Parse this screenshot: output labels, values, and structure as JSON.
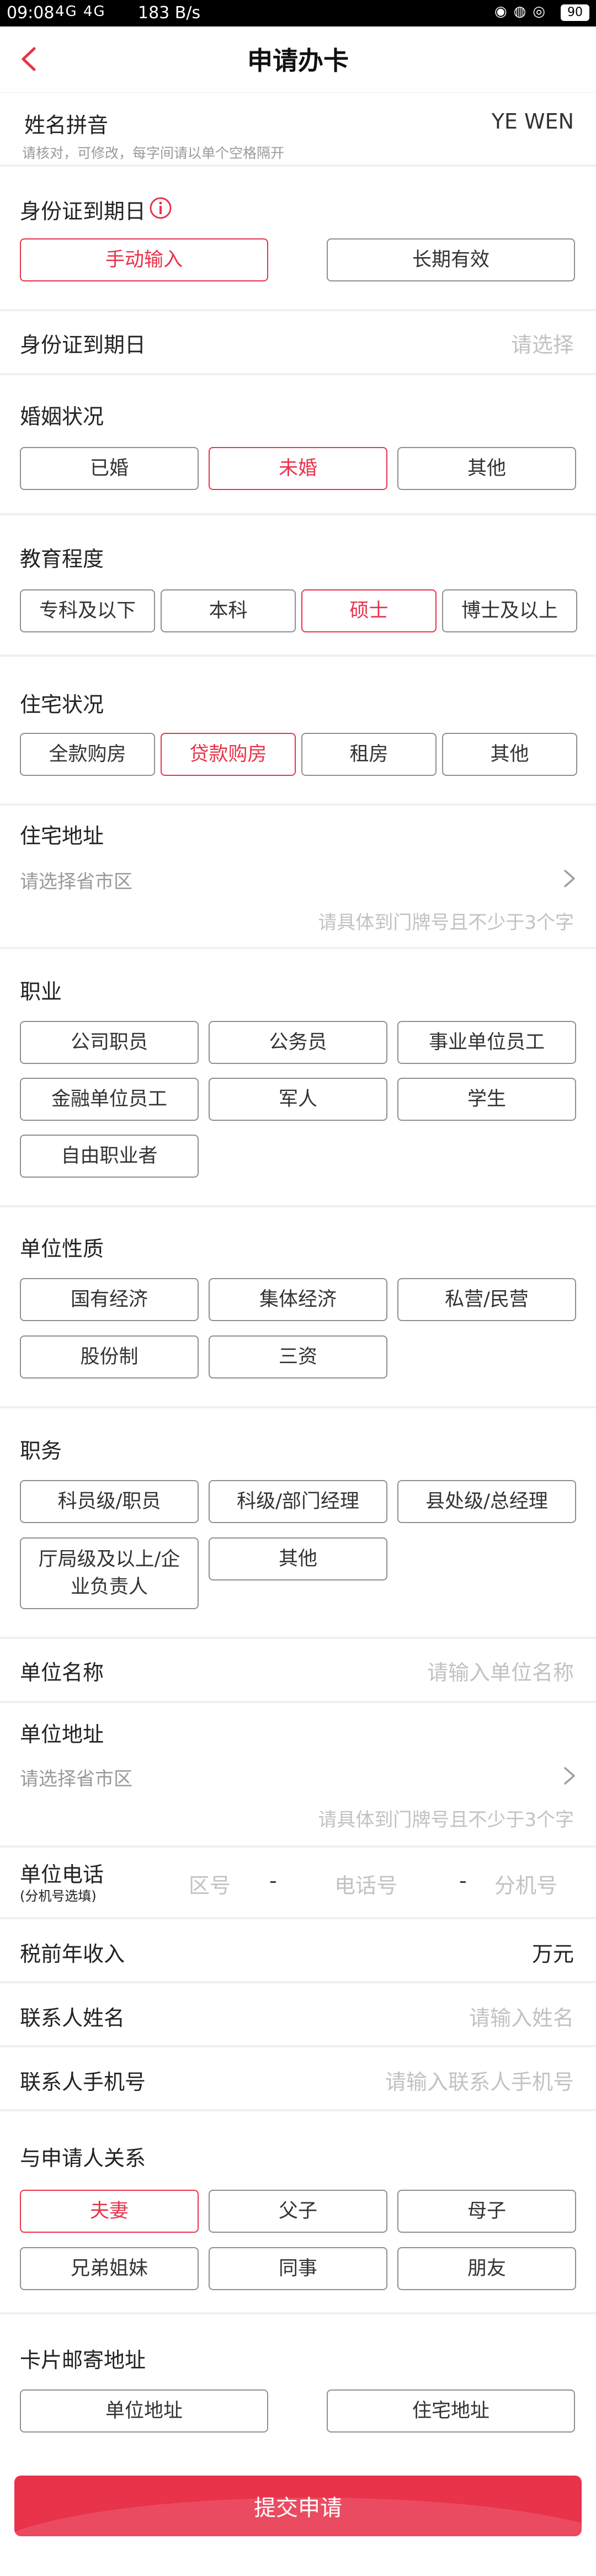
{
  "status_bar": {
    "time": "09:08",
    "signal": "4G 4G",
    "speed": "183 B/s",
    "battery": "90"
  },
  "nav": {
    "title": "申请办卡"
  },
  "name_pinyin": {
    "label": "姓名拼音",
    "value": "YE WEN",
    "hint": "请核对，可修改，每字间请以单个空格隔开"
  },
  "id_expiry_mode": {
    "label": "身份证到期日",
    "options": [
      "手动输入",
      "长期有效"
    ],
    "selected": "手动输入"
  },
  "id_expiry_date": {
    "label": "身份证到期日",
    "placeholder": "请选择"
  },
  "marital": {
    "label": "婚姻状况",
    "options": [
      "已婚",
      "未婚",
      "其他"
    ],
    "selected": "未婚"
  },
  "education": {
    "label": "教育程度",
    "options": [
      "专科及以下",
      "本科",
      "硕士",
      "博士及以上"
    ],
    "selected": "硕士"
  },
  "housing": {
    "label": "住宅状况",
    "options": [
      "全款购房",
      "贷款购房",
      "租房",
      "其他"
    ],
    "selected": "贷款购房"
  },
  "home_address": {
    "label": "住宅地址",
    "region_placeholder": "请选择省市区",
    "detail_placeholder": "请具体到门牌号且不少于3个字"
  },
  "occupation": {
    "label": "职业",
    "options": [
      "公司职员",
      "公务员",
      "事业单位员工",
      "金融单位员工",
      "军人",
      "学生",
      "自由职业者"
    ]
  },
  "company_type": {
    "label": "单位性质",
    "options": [
      "国有经济",
      "集体经济",
      "私营/民营",
      "股份制",
      "三资"
    ]
  },
  "position": {
    "label": "职务",
    "options": [
      "科员级/职员",
      "科级/部门经理",
      "县处级/总经理",
      "厅局级及以上/企业负责人",
      "其他"
    ]
  },
  "company_name": {
    "label": "单位名称",
    "placeholder": "请输入单位名称"
  },
  "company_address": {
    "label": "单位地址",
    "region_placeholder": "请选择省市区",
    "detail_placeholder": "请具体到门牌号且不少于3个字"
  },
  "company_phone": {
    "label": "单位电话",
    "sublabel": "(分机号选填)",
    "area_placeholder": "区号",
    "sep1": "-",
    "number_placeholder": "电话号",
    "sep2": "-",
    "ext_placeholder": "分机号"
  },
  "income": {
    "label": "税前年收入",
    "unit": "万元"
  },
  "contact_name": {
    "label": "联系人姓名",
    "placeholder": "请输入姓名"
  },
  "contact_phone": {
    "label": "联系人手机号",
    "placeholder": "请输入联系人手机号"
  },
  "relationship": {
    "label": "与申请人关系",
    "options": [
      "夫妻",
      "父子",
      "母子",
      "兄弟姐妹",
      "同事",
      "朋友"
    ],
    "selected": "夫妻"
  },
  "mailing_address": {
    "label": "卡片邮寄地址",
    "options": [
      "单位地址",
      "住宅地址"
    ]
  },
  "submit": {
    "label": "提交申请"
  },
  "colors": {
    "accent": "#e8334a",
    "border": "#8f8f8f",
    "placeholder": "#c2c2c2"
  }
}
